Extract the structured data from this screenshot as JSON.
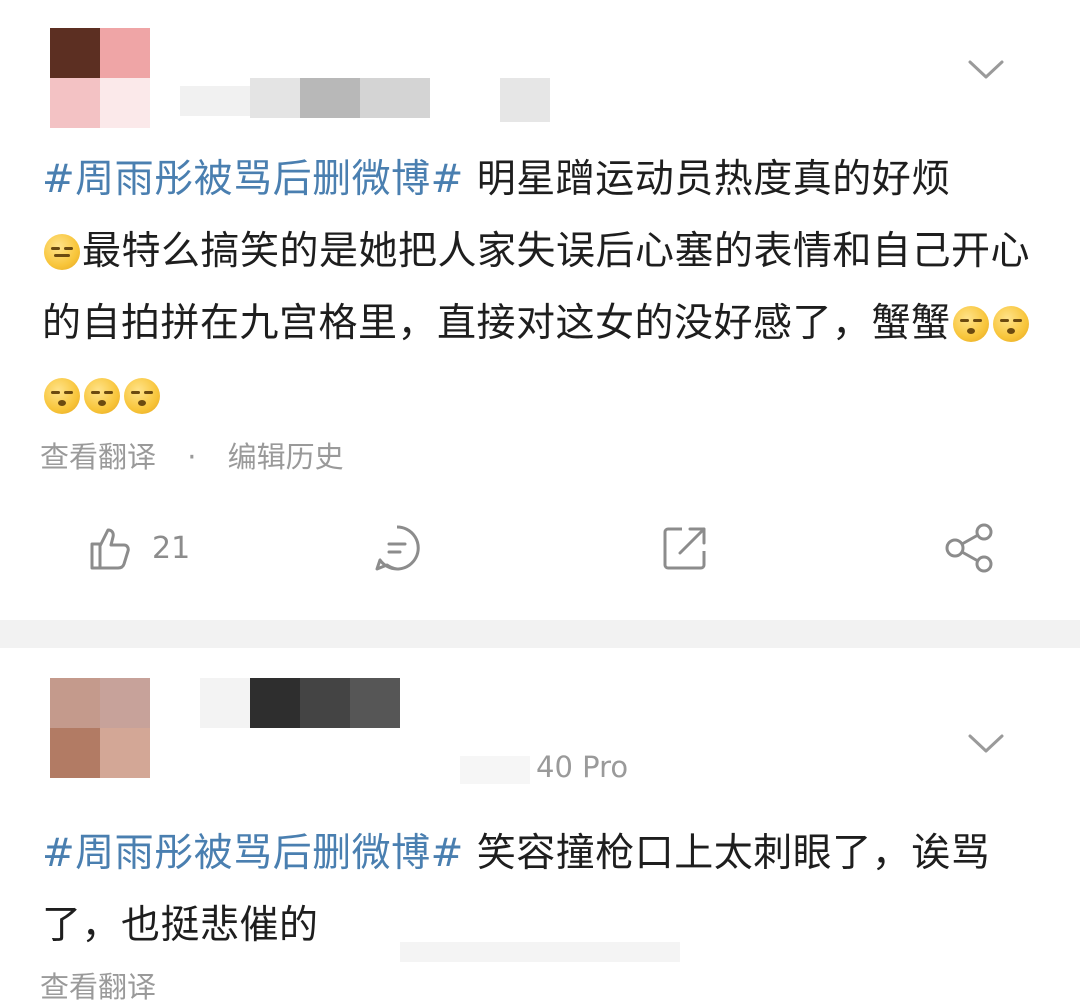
{
  "posts": [
    {
      "content_tag": "#周雨彤被骂后删微博#",
      "content_text_1": " 明星蹭运动员热度真的好烦",
      "content_text_2": "最特么搞笑的是她把人家失误后心塞的表情和自己开心的自拍拼在九宫格里，直接对这女的没好感了，蟹蟹",
      "translate_label": "查看翻译",
      "separator": "·",
      "edit_history_label": "编辑历史",
      "like_count": "21",
      "icons": [
        "chevron-down-icon",
        "thumbs-up-icon",
        "comment-icon",
        "repost-icon",
        "share-icon"
      ]
    },
    {
      "device": "40 Pro",
      "content_tag": "#周雨彤被骂后删微博#",
      "content_text": " 笑容撞枪口上太刺眼了，诶骂了，也挺悲催的",
      "translate_label": "查看翻译"
    }
  ],
  "colors": {
    "tag": "#4a7fb0",
    "meta": "#9a9a9a",
    "divider": "#f2f2f2"
  }
}
